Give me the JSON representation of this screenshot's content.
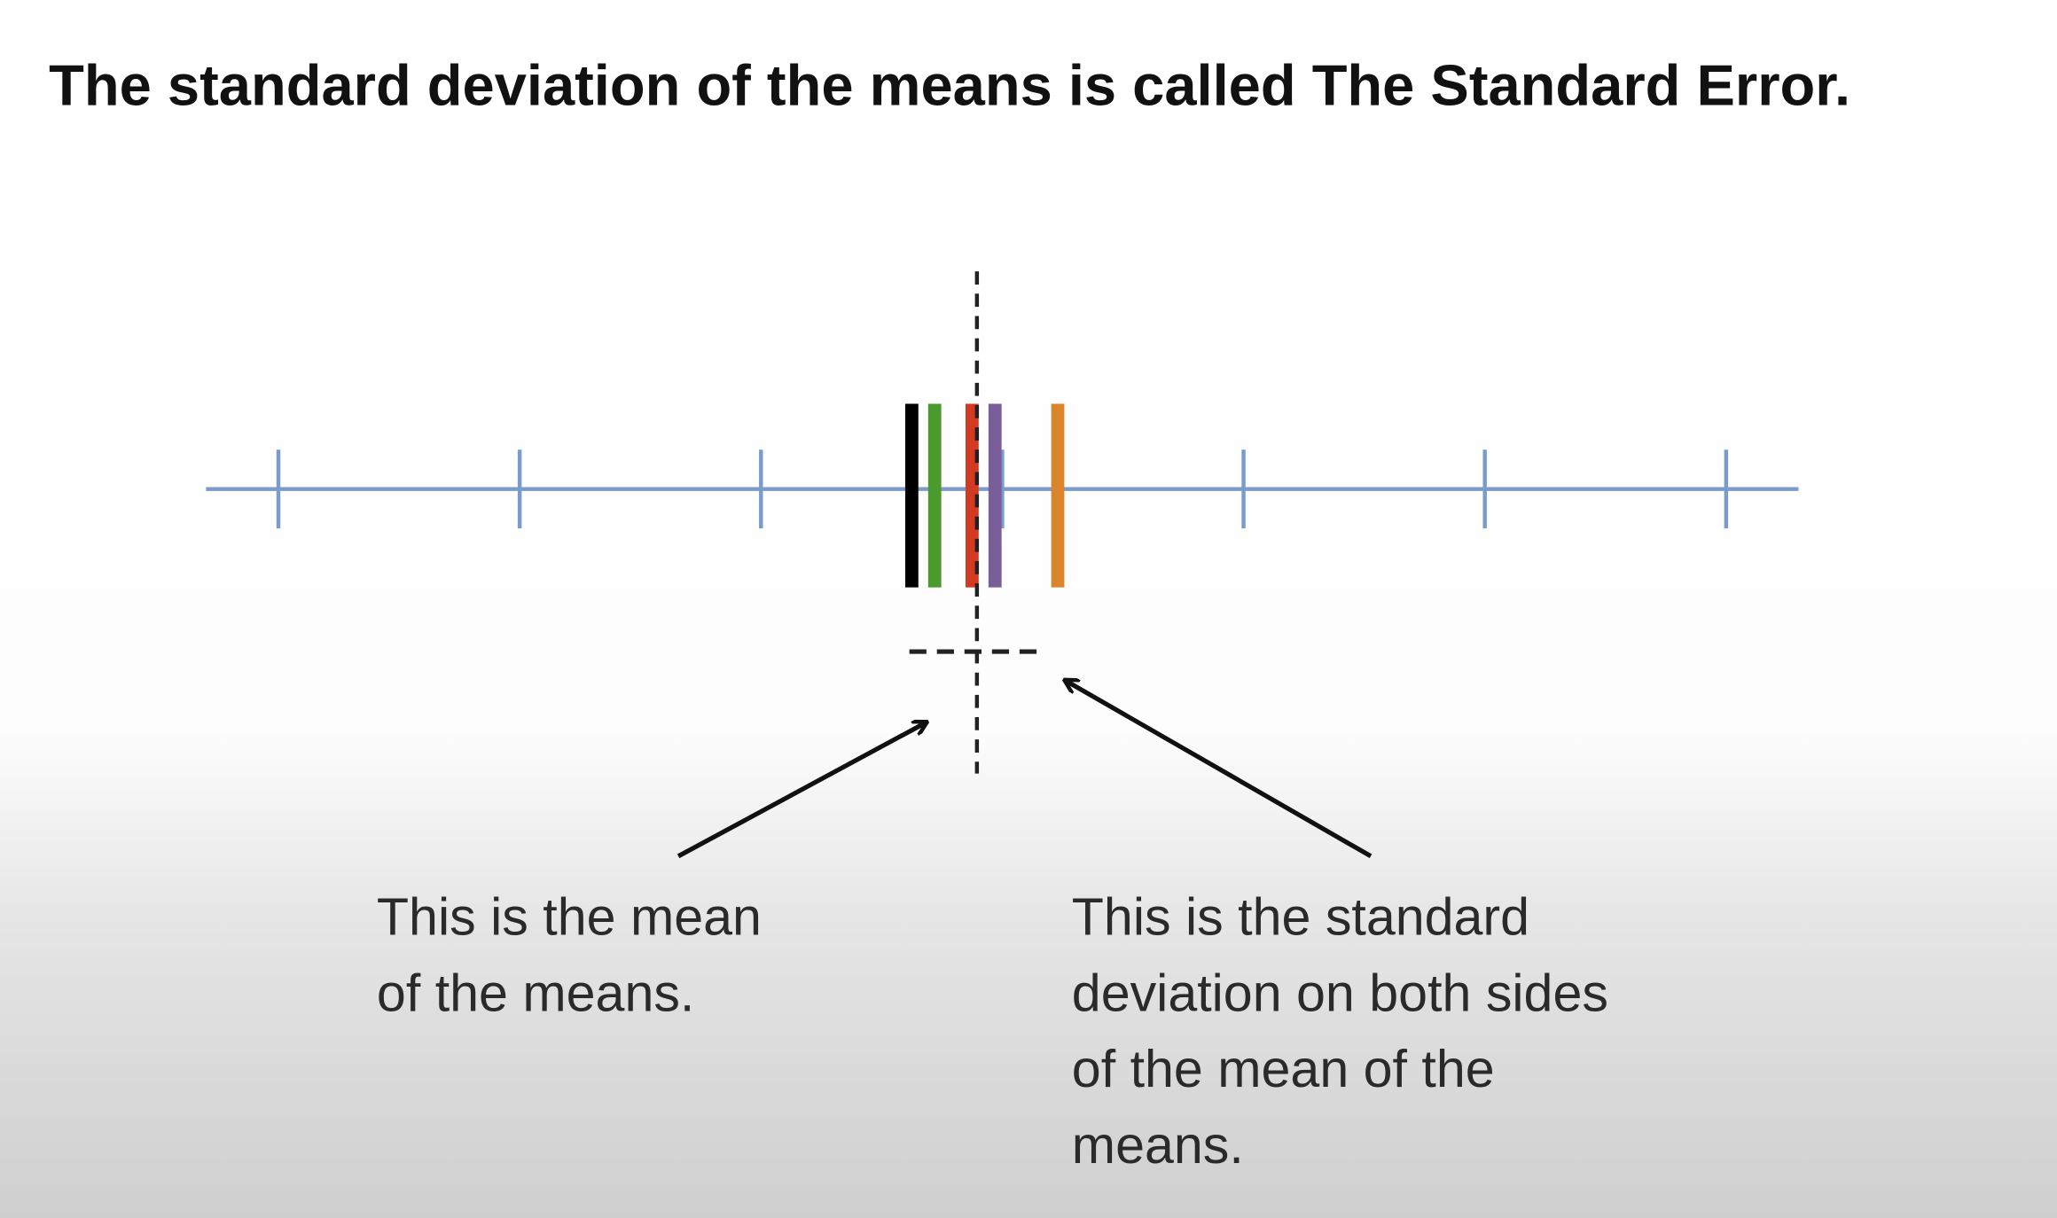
{
  "title": "The standard deviation of the means is called The Standard Error.",
  "diagram": {
    "axis_color": "#7b9bcc",
    "ticks": [
      -3,
      -2,
      -1,
      0,
      1,
      2,
      3
    ],
    "hidden_ticks": [
      0
    ],
    "axis_range": [
      -3.3,
      3.3
    ],
    "means": [
      {
        "name": "black",
        "value": -0.375,
        "color": "#000000"
      },
      {
        "name": "green",
        "value": -0.28,
        "color": "#4a9a2e"
      },
      {
        "name": "red",
        "value": -0.125,
        "color": "#d23a22"
      },
      {
        "name": "purple",
        "value": -0.03,
        "color": "#7a5e9a"
      },
      {
        "name": "orange",
        "value": 0.23,
        "color": "#d9852c"
      }
    ],
    "mean_of_means": -0.105,
    "standard_error": 0.28
  },
  "captions": {
    "left": [
      "This is the mean",
      "of the means."
    ],
    "right": [
      "This is the standard",
      "deviation on both sides",
      "of the mean of the",
      "means."
    ]
  }
}
